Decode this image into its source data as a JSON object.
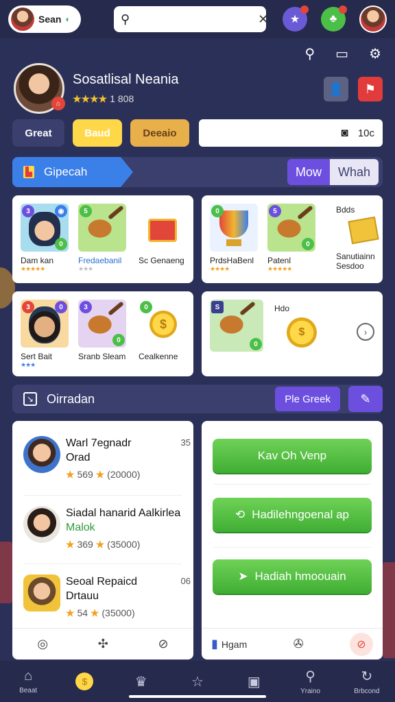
{
  "topbar": {
    "user_name": "Sean",
    "search_placeholder": "",
    "icons": [
      "search-icon",
      "close-icon",
      "gift-icon",
      "game-icon"
    ]
  },
  "header_icons": [
    "search-icon",
    "chart-icon",
    "settings-icon"
  ],
  "profile": {
    "name": "Sosatlisal Neania",
    "stars": "★★★★",
    "score": "1 808"
  },
  "actions": {
    "btn1": "Great",
    "btn2": "Baud",
    "btn3": "Deeaio",
    "coins": "10c"
  },
  "banner": {
    "title": "Gipecah",
    "tab_active": "Mow",
    "tab_other": "Whah"
  },
  "grid1": {
    "left": [
      {
        "label": "Dam kan",
        "stars": "★★★★★"
      },
      {
        "label": "Fredaebanil",
        "stars": "★★★"
      },
      {
        "label": "Sc Genaeng",
        "stars": ""
      }
    ],
    "right": [
      {
        "label": "PrdsHaBenl",
        "stars": "★★★★"
      },
      {
        "label": "Patenl",
        "stars": "★★★★★"
      },
      {
        "label": "Sanutiainn",
        "sub": "Sesdoo"
      }
    ],
    "right_header": "Bdds"
  },
  "grid2": {
    "left": [
      {
        "label": "Sert Bait",
        "stars": "★★★"
      },
      {
        "label": "Sranb Sleam",
        "stars": ""
      },
      {
        "label": "Cealkenne",
        "stars": ""
      }
    ],
    "right_label": "Hdo"
  },
  "section2": {
    "title": "Oirradan",
    "button": "Ple Greek"
  },
  "list": [
    {
      "title": "Warl 7egnadr",
      "title2": "Orad",
      "num": "35",
      "stars": "569",
      "count": "(20000)"
    },
    {
      "title": "Siadal hanarid Aalkirlea",
      "title2": "Malok",
      "num": "",
      "stars": "369",
      "count": "(35000)"
    },
    {
      "title": "Seoal Repaicd",
      "title2": "Drtauu",
      "num": "06",
      "stars": "54",
      "count": "(35000)"
    }
  ],
  "green_buttons": [
    "Kav Oh Venp",
    "Hadilehngoenal ap",
    "Hadiah hmoouain"
  ],
  "card_right_footer": "Hgam",
  "bottom_nav": [
    {
      "label": "Beaat",
      "icon": "home-icon"
    },
    {
      "label": "",
      "icon": "coin-icon"
    },
    {
      "label": "",
      "icon": "trophy-icon"
    },
    {
      "label": "",
      "icon": "star-icon"
    },
    {
      "label": "",
      "icon": "tv-icon"
    },
    {
      "label": "Yraino",
      "icon": "search-icon"
    },
    {
      "label": "Brbcond",
      "icon": "refresh-icon"
    }
  ]
}
